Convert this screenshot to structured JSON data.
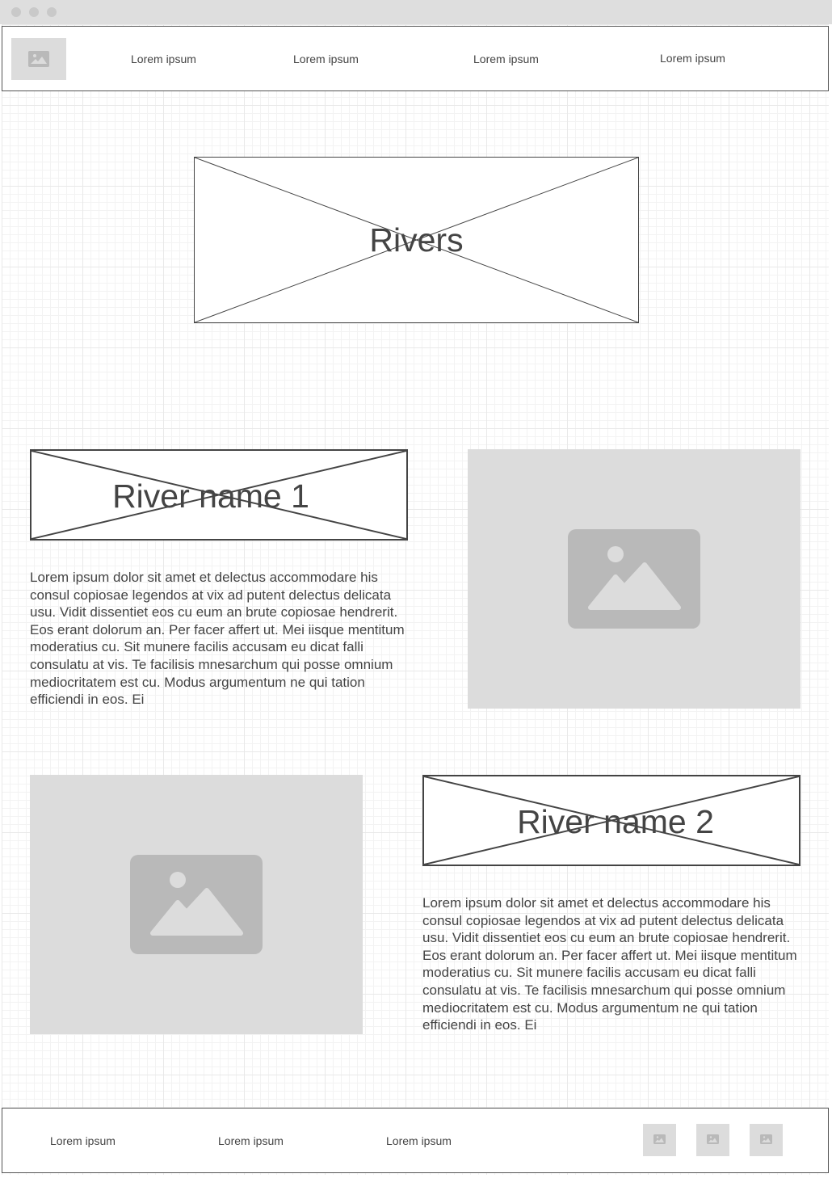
{
  "header": {
    "logo_icon": "image-icon",
    "nav": [
      "Lorem ipsum",
      "Lorem ipsum",
      "Lorem ipsum",
      "Lorem ipsum"
    ]
  },
  "hero": {
    "title": "Rivers"
  },
  "sections": [
    {
      "title": "River name 1",
      "body": "Lorem ipsum dolor sit amet et delectus accommodare his consul copiosae legendos at vix ad putent delectus delicata usu. Vidit dissentiet eos cu eum an brute copiosae hendrerit. Eos erant dolorum an. Per facer affert ut. Mei iisque mentitum moderatius cu. Sit munere facilis accusam eu dicat falli consulatu at vis. Te facilisis mnesarchum qui posse omnium mediocritatem est cu. Modus argumentum ne qui tation efficiendi in eos. Ei",
      "image_icon": "image-icon"
    },
    {
      "title": "River name 2",
      "body": "Lorem ipsum dolor sit amet et delectus accommodare his consul copiosae legendos at vix ad putent delectus delicata usu. Vidit dissentiet eos cu eum an brute copiosae hendrerit. Eos erant dolorum an. Per facer affert ut. Mei iisque mentitum moderatius cu. Sit munere facilis accusam eu dicat falli consulatu at vis. Te facilisis mnesarchum qui posse omnium mediocritatem est cu. Modus argumentum ne qui tation efficiendi in eos. Ei",
      "image_icon": "image-icon"
    }
  ],
  "footer": {
    "links": [
      "Lorem ipsum",
      "Lorem ipsum",
      "Lorem ipsum"
    ],
    "social_icons": [
      "image-icon",
      "image-icon",
      "image-icon"
    ]
  },
  "colors": {
    "placeholder_fill": "#dcdcdc",
    "placeholder_icon": "#b9b9b9",
    "stroke": "#444444",
    "text": "#444444"
  }
}
